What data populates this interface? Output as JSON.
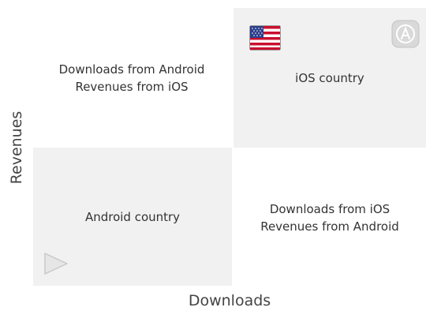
{
  "quadrants": {
    "top_left": {
      "line1": "Downloads from Android",
      "line2": "Revenues from iOS"
    },
    "top_right": {
      "label": "iOS country"
    },
    "bottom_left": {
      "label": "Android country"
    },
    "bottom_right": {
      "line1": "Downloads from iOS",
      "line2": "Revenues from Android"
    }
  },
  "axes": {
    "x_label": "Downloads",
    "y_label": "Revenues"
  },
  "icons": [
    "us-flag-icon",
    "app-store-icon",
    "google-play-icon"
  ],
  "colors": {
    "gray_quadrant": "#f1f1f1",
    "white_quadrant": "#ffffff"
  }
}
